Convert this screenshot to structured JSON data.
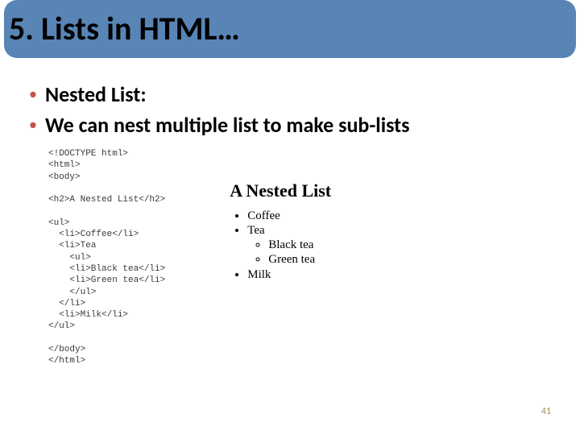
{
  "header": {
    "title": "5. Lists in HTML…"
  },
  "bullets": {
    "b1": "Nested List:",
    "b2": "We can nest multiple list to make sub-lists"
  },
  "code": {
    "text": "<!DOCTYPE html>\n<html>\n<body>\n\n<h2>A Nested List</h2>\n\n<ul>\n  <li>Coffee</li>\n  <li>Tea\n    <ul>\n    <li>Black tea</li>\n    <li>Green tea</li>\n    </ul>\n  </li>\n  <li>Milk</li>\n</ul>\n\n</body>\n</html>"
  },
  "output": {
    "heading": "A Nested List",
    "items": {
      "i1": "Coffee",
      "i2": "Tea",
      "i2a": "Black tea",
      "i2b": "Green tea",
      "i3": "Milk"
    }
  },
  "page_number": "41"
}
